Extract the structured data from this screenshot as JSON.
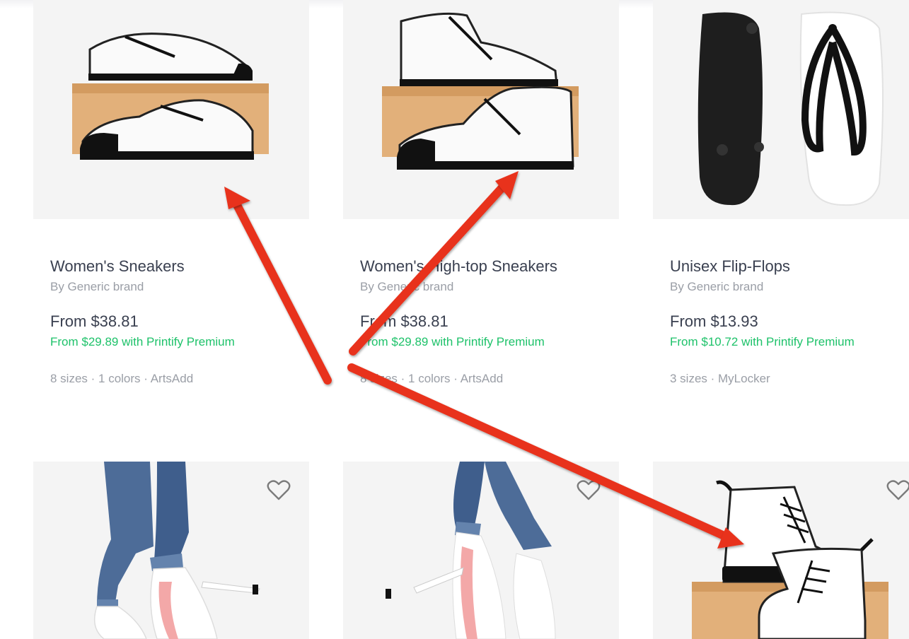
{
  "products": [
    {
      "title": "Women's Sneakers",
      "brand": "By Generic brand",
      "price": "From $38.81",
      "premium": "From $29.89 with Printify Premium",
      "meta": "8 sizes · 1 colors · ArtsAdd",
      "image": "low-top-sneakers-on-shoebox"
    },
    {
      "title": "Women's High-top Sneakers",
      "brand": "By Generic brand",
      "price": "From $38.81",
      "premium": "From $29.89 with Printify Premium",
      "meta": "8 sizes · 1 colors · ArtsAdd",
      "image": "high-top-sneakers-on-shoebox"
    },
    {
      "title": "Unisex Flip-Flops",
      "brand": "By Generic brand",
      "price": "From $13.93",
      "premium": "From $10.72 with Printify Premium",
      "meta": "3 sizes · MyLocker",
      "image": "flip-flops"
    }
  ],
  "second_row": [
    {
      "image": "high-heels-left",
      "favorite_icon": "heart-outline-icon"
    },
    {
      "image": "high-heels-right",
      "favorite_icon": "heart-outline-icon"
    },
    {
      "image": "lace-up-boots-on-shoebox",
      "favorite_icon": "heart-outline-icon"
    }
  ],
  "colors": {
    "accent_green": "#1ec26a",
    "annotation_red": "#e8321c",
    "card_background": "#f4f4f4"
  }
}
